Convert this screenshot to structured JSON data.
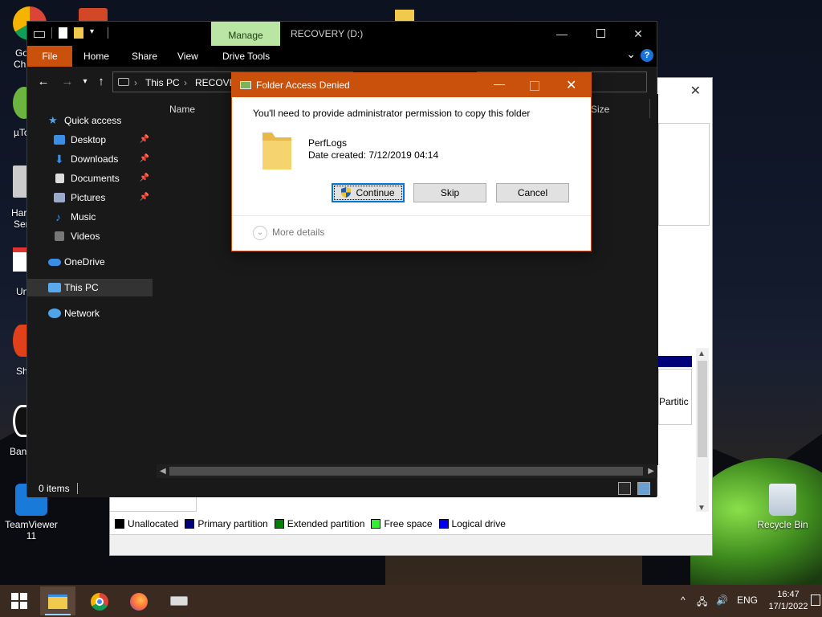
{
  "desktop": {
    "icons_left_partial": [
      "Go",
      "Chr",
      "µTo",
      "Har",
      "Ser",
      "Un",
      "Sh",
      "Ban"
    ],
    "teamviewer_label_1": "TeamViewer",
    "teamviewer_label_2": "11",
    "recycle_bin_label": "Recycle Bin"
  },
  "disk_window": {
    "partition_label": "Partitic",
    "legend": [
      {
        "label": "Unallocated",
        "color": "#000000"
      },
      {
        "label": "Primary partition",
        "color": "#00007a"
      },
      {
        "label": "Extended partition",
        "color": "#008000"
      },
      {
        "label": "Free space",
        "color": "#33ee33"
      },
      {
        "label": "Logical drive",
        "color": "#0000ee"
      }
    ]
  },
  "explorer": {
    "context_tab": "Manage",
    "title": "RECOVERY (D:)",
    "ribbon_tabs": {
      "file": "File",
      "home": "Home",
      "share": "Share",
      "view": "View",
      "drive_tools": "Drive Tools"
    },
    "breadcrumb": {
      "this_pc": "This PC",
      "drive": "RECOVER"
    },
    "columns": {
      "name": "Name",
      "size": "Size"
    },
    "nav": {
      "quick_access": "Quick access",
      "desktop": "Desktop",
      "downloads": "Downloads",
      "documents": "Documents",
      "pictures": "Pictures",
      "music": "Music",
      "videos": "Videos",
      "onedrive": "OneDrive",
      "this_pc": "This PC",
      "network": "Network"
    },
    "status": {
      "items": "0 items"
    }
  },
  "dialog": {
    "title": "Folder Access Denied",
    "message": "You'll need to provide administrator permission to copy this folder",
    "folder_name": "PerfLogs",
    "date_created": "Date created: 7/12/2019 04:14",
    "buttons": {
      "continue": "Continue",
      "skip": "Skip",
      "cancel": "Cancel"
    },
    "more_details": "More details"
  },
  "taskbar": {
    "tray_lang": "ENG",
    "time": "16:47",
    "date": "17/1/2022"
  },
  "colors": {
    "accent_orange": "#c9510c",
    "manage_green": "#b9e6a3",
    "explorer_bg": "#191919"
  }
}
